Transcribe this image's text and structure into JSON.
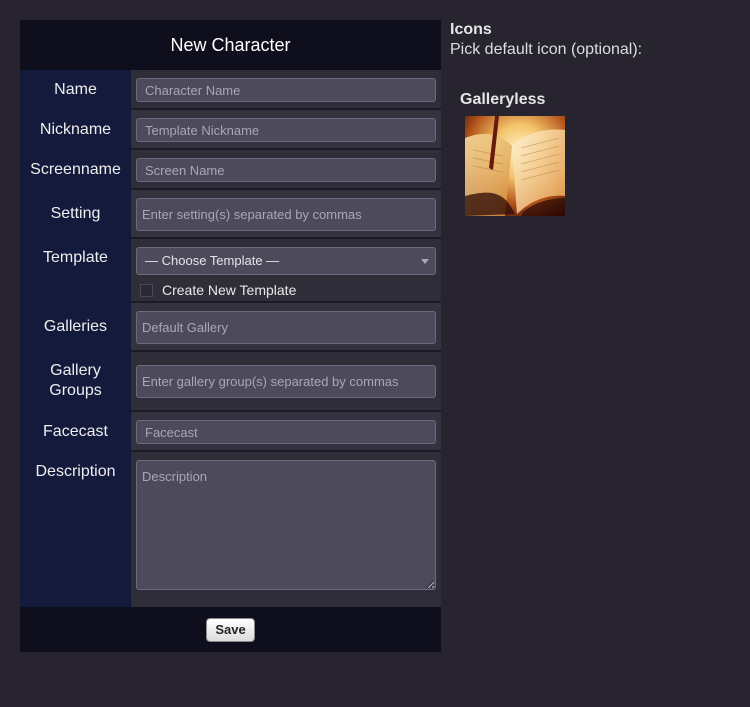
{
  "form": {
    "title": "New Character",
    "save_label": "Save",
    "fields": {
      "name": {
        "label": "Name",
        "placeholder": "Character Name",
        "value": ""
      },
      "nickname": {
        "label": "Nickname",
        "placeholder": "Template Nickname",
        "value": ""
      },
      "screenname": {
        "label": "Screenname",
        "placeholder": "Screen Name",
        "value": ""
      },
      "setting": {
        "label": "Setting",
        "placeholder": "Enter setting(s) separated by commas",
        "value": ""
      },
      "template": {
        "label": "Template",
        "selected": "— Choose Template —",
        "create_new_label": "Create New Template",
        "create_new_checked": false
      },
      "galleries": {
        "label": "Galleries",
        "placeholder": "Default Gallery",
        "value": ""
      },
      "gallery_groups": {
        "label": "Gallery\nGroups",
        "placeholder": "Enter gallery group(s) separated by commas",
        "value": ""
      },
      "facecast": {
        "label": "Facecast",
        "placeholder": "Facecast",
        "value": ""
      },
      "description": {
        "label": "Description",
        "placeholder": "Description",
        "value": ""
      }
    }
  },
  "icons_panel": {
    "title": "Icons",
    "subtitle": "Pick default icon (optional):",
    "gallery": {
      "name": "Galleryless",
      "icon": "open-book-image"
    }
  }
}
